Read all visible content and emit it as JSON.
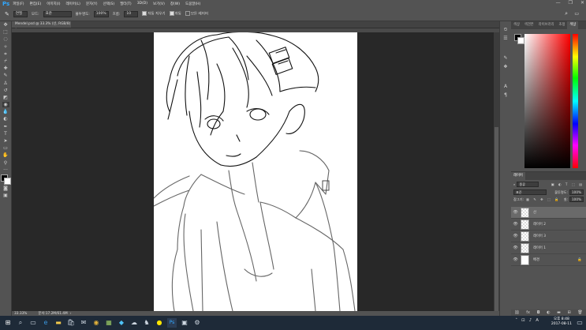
{
  "menubar": {
    "logo": "Ps",
    "items": [
      "파일(F)",
      "편집(E)",
      "이미지(I)",
      "레이어(L)",
      "문자(Y)",
      "선택(S)",
      "필터(T)",
      "3D(D)",
      "보기(V)",
      "창(W)",
      "도움말(H)"
    ],
    "window_controls": [
      "—",
      "❐",
      "✕"
    ]
  },
  "options": {
    "preset": "연필",
    "mode_label": "모드:",
    "mode_value": "표준",
    "opacity_label": "불투명도:",
    "opacity_value": "100%",
    "smoothing_label": "흐름:",
    "smoothing_value": "10",
    "auto_erase": "자동 지우기",
    "sample": "자동",
    "extra": "모든 레이어"
  },
  "document": {
    "tab_title": "Mendel.psd @ 33.3% (선, RGB/8) *",
    "tab_close": "×",
    "zoom": "33.33%",
    "doc_info": "문서:17.2M/61.4M"
  },
  "color_panel": {
    "tabs": [
      "색상",
      "색견본",
      "라이브러리",
      "조정",
      "패턴",
      "색상"
    ],
    "fg_color": "#000000",
    "bg_color": "#ffffff"
  },
  "layers_panel": {
    "tab_label": "레이어",
    "filter_label": "종류",
    "blend_mode": "표준",
    "opacity_label": "불투명도:",
    "opacity_value": "100%",
    "lock_label": "잠그기:",
    "fill_label": "칠:",
    "fill_value": "100%",
    "layers": [
      {
        "name": "선",
        "selected": true
      },
      {
        "name": "레이어 2",
        "selected": false
      },
      {
        "name": "레이어 3",
        "selected": false
      },
      {
        "name": "레이어 1",
        "selected": false
      },
      {
        "name": "배경",
        "selected": false
      }
    ],
    "footer_icons": [
      "link-icon",
      "fx-icon",
      "mask-icon",
      "adjustment-icon",
      "folder-icon",
      "new-layer-icon",
      "trash-icon"
    ]
  },
  "taskbar": {
    "time": "오후 8:48",
    "date": "2017-08-11",
    "ime": "A"
  }
}
